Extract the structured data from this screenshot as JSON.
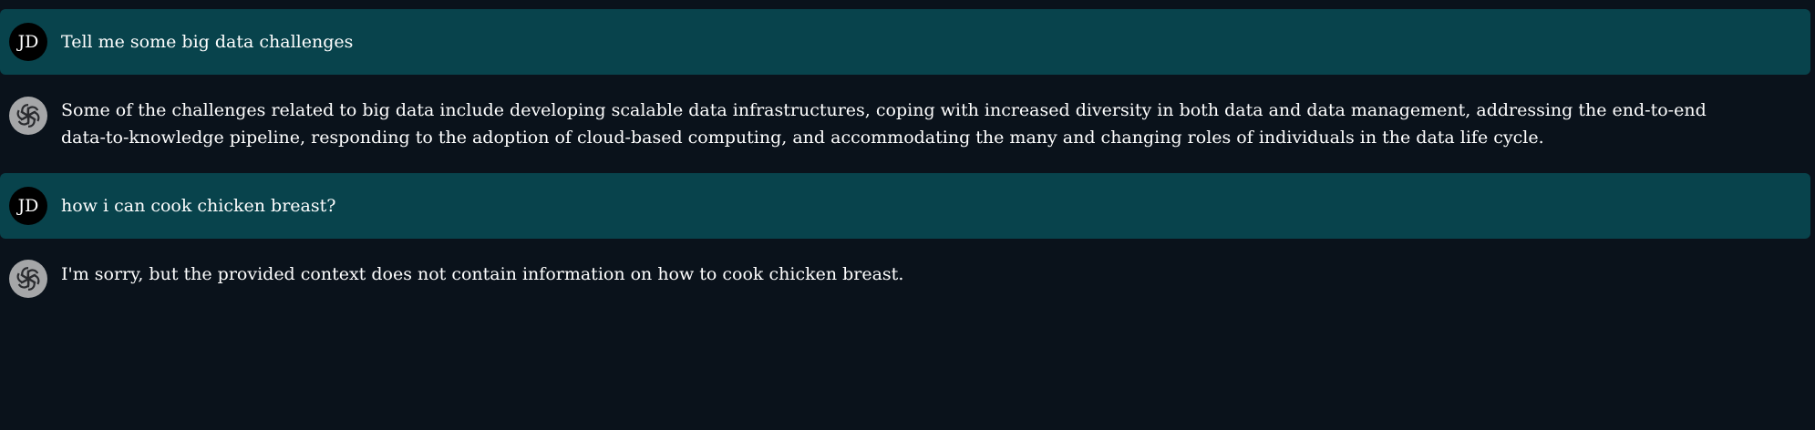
{
  "messages": [
    {
      "role": "user",
      "avatar_initials": "JD",
      "text": "Tell me some big data challenges"
    },
    {
      "role": "assistant",
      "avatar_icon": "chatgpt-logo-icon",
      "text": "Some of the challenges related to big data include developing scalable data infrastructures, coping with increased diversity in both data and data management, addressing the end-to-end data-to-knowledge pipeline, responding to the adoption of cloud-based computing, and accommodating the many and changing roles of individuals in the data life cycle."
    },
    {
      "role": "user",
      "avatar_initials": "JD",
      "text": "how i can cook chicken breast?"
    },
    {
      "role": "assistant",
      "avatar_icon": "chatgpt-logo-icon",
      "text": "I'm sorry, but the provided context does not contain information on how to cook chicken breast."
    }
  ],
  "colors": {
    "background": "#0a121b",
    "user_bubble": "#08434c",
    "user_avatar": "#000000",
    "assistant_avatar": "#a5a6a8",
    "text": "#ffffff"
  }
}
